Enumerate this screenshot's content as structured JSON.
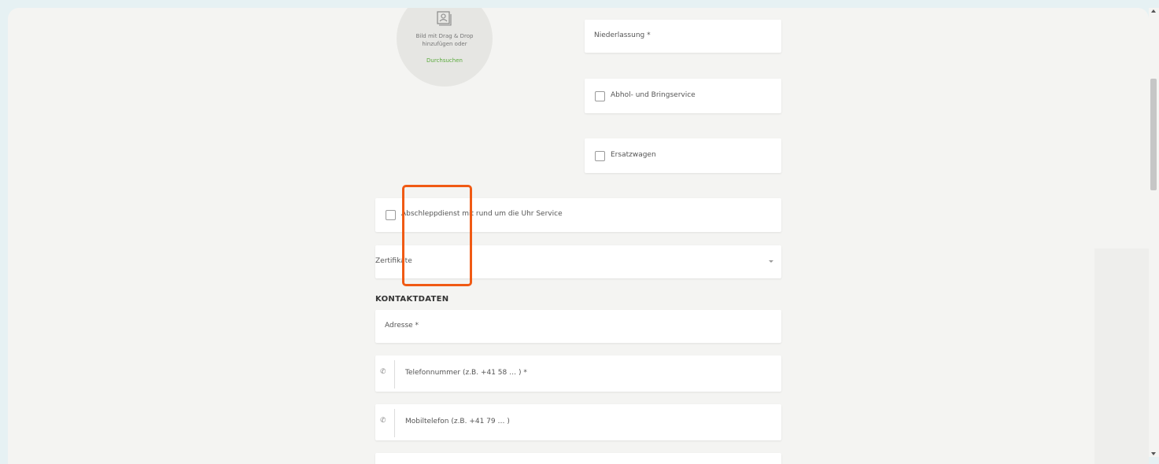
{
  "upload": {
    "line1": "Bild mit Drag & Drop",
    "line2": "hinzufügen oder",
    "link": "Durchsuchen"
  },
  "fields": {
    "niederlassung": "Niederlassung *",
    "abhol_label": "Abhol- und Bringservice",
    "ersatzwagen_label": "Ersatzwagen",
    "abschlepp_label": "Abschleppdienst mit rund um die Uhr Service",
    "zertifikate": "Zertifikate"
  },
  "contact": {
    "section_title": "KONTAKTDATEN",
    "adresse": "Adresse *",
    "telefon_placeholder": "Telefonnummer (z.B. +41 58 … ) *",
    "mobil_placeholder": "Mobiltelefon (z.B. +41 79 … )",
    "phone_prefix_symbol": "✆"
  },
  "colors": {
    "accent_green": "#5aaa3c",
    "highlight_orange": "#f05a14",
    "page_bg": "#f4f4f2"
  }
}
